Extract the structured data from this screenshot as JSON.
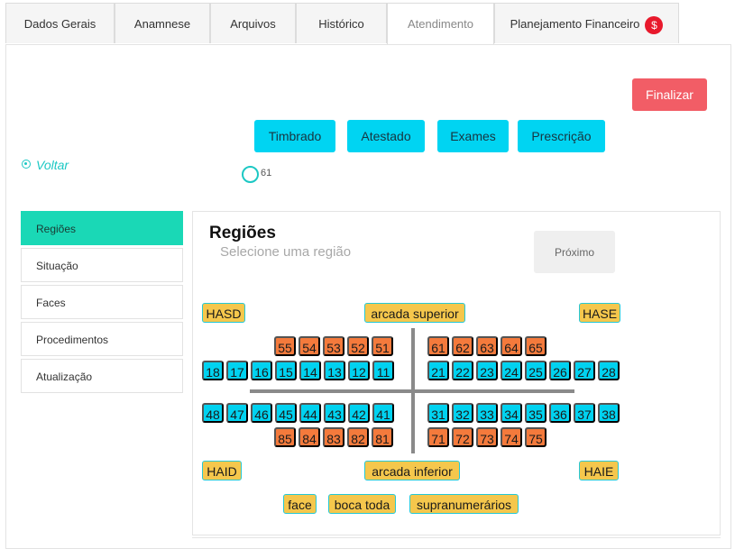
{
  "tabs": [
    {
      "label": "Dados Gerais"
    },
    {
      "label": "Anamnese"
    },
    {
      "label": "Arquivos"
    },
    {
      "label": "Histórico"
    },
    {
      "label": "Atendimento"
    },
    {
      "label": "Planejamento Financeiro",
      "badge": "$"
    }
  ],
  "actions": {
    "finalizar": "Finalizar",
    "timbrado": "Timbrado",
    "atestado": "Atestado",
    "exames": "Exames",
    "prescricao": "Prescrição"
  },
  "voltar": "Voltar",
  "selected_tooth": "61",
  "sidebar": {
    "items": [
      {
        "label": "Regiões"
      },
      {
        "label": "Situação"
      },
      {
        "label": "Faces"
      },
      {
        "label": "Procedimentos"
      },
      {
        "label": "Atualização"
      }
    ]
  },
  "regions": {
    "title": "Regiões",
    "subtitle": "Selecione uma região",
    "next_button": "Próximo",
    "corners": {
      "hasd": "HASD",
      "hase": "HASE",
      "haid": "HAID",
      "haie": "HAIE"
    },
    "arcada_superior": "arcada superior",
    "arcada_inferior": "arcada inferior",
    "upper_deciduous_right": [
      "55",
      "54",
      "53",
      "52",
      "51"
    ],
    "upper_deciduous_left": [
      "61",
      "62",
      "63",
      "64",
      "65"
    ],
    "upper_permanent_right": [
      "18",
      "17",
      "16",
      "15",
      "14",
      "13",
      "12",
      "11"
    ],
    "upper_permanent_left": [
      "21",
      "22",
      "23",
      "24",
      "25",
      "26",
      "27",
      "28"
    ],
    "lower_permanent_right": [
      "48",
      "47",
      "46",
      "45",
      "44",
      "43",
      "42",
      "41"
    ],
    "lower_permanent_left": [
      "31",
      "32",
      "33",
      "34",
      "35",
      "36",
      "37",
      "38"
    ],
    "lower_deciduous_right": [
      "85",
      "84",
      "83",
      "82",
      "81"
    ],
    "lower_deciduous_left": [
      "71",
      "72",
      "73",
      "74",
      "75"
    ],
    "extras": [
      "face",
      "boca toda",
      "supranumerários"
    ]
  },
  "colors": {
    "permanent": "#00d2f0",
    "deciduous": "#f47a3c",
    "region": "#f5c74c",
    "accent": "#1ad8b6",
    "finalizar": "#f25d66"
  }
}
